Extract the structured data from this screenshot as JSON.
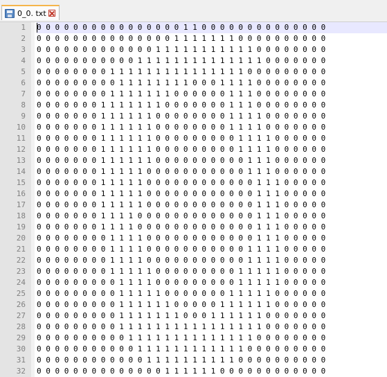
{
  "tab": {
    "label": "0_0. txt"
  },
  "editor": {
    "current_line": 1,
    "line_numbers": [
      "1",
      "2",
      "3",
      "4",
      "5",
      "6",
      "7",
      "8",
      "9",
      "10",
      "11",
      "12",
      "13",
      "14",
      "15",
      "16",
      "17",
      "18",
      "19",
      "20",
      "21",
      "22",
      "23",
      "24",
      "25",
      "26",
      "27",
      "28",
      "29",
      "30",
      "31",
      "32"
    ],
    "lines": [
      "0 0 0 0 0 0 0 0 0 0 0 0 0 0 0 0 1 1 0 0 0 0 0 0 0 0 0 0 0 0 0 0",
      "0 0 0 0 0 0 0 0 0 0 0 0 0 0 0 1 1 1 1 1 1 1 0 0 0 0 0 0 0 0 0 0",
      "0 0 0 0 0 0 0 0 0 0 0 0 0 1 1 1 1 1 1 1 1 1 1 1 0 0 0 0 0 0 0 0",
      "0 0 0 0 0 0 0 0 0 0 0 1 1 1 1 1 1 1 1 1 1 1 1 1 1 0 0 0 0 0 0 0",
      "0 0 0 0 0 0 0 0 1 1 1 1 1 1 1 1 1 1 1 1 1 1 1 0 0 0 0 0 0 0 0 0",
      "0 0 0 0 0 0 0 0 0 1 1 1 1 1 1 1 1 0 0 0 1 1 1 1 0 0 0 0 0 0 0 0",
      "0 0 0 0 0 0 0 0 1 1 1 1 1 1 1 0 0 0 0 0 0 1 1 1 0 0 0 0 0 0 0 0",
      "0 0 0 0 0 0 0 1 1 1 1 1 1 1 0 0 0 0 0 0 0 1 1 1 0 0 0 0 0 0 0 0",
      "0 0 0 0 0 0 0 1 1 1 1 1 1 0 0 0 0 0 0 0 0 1 1 1 1 0 0 0 0 0 0 0",
      "0 0 0 0 0 0 0 1 1 1 1 1 1 0 0 0 0 0 0 0 0 1 1 1 1 0 0 0 0 0 0 0",
      "0 0 0 0 0 0 0 1 1 1 1 1 1 0 0 0 0 0 0 0 0 0 1 1 1 1 0 0 0 0 0 0",
      "0 0 0 0 0 0 0 1 1 1 1 1 1 0 0 0 0 0 0 0 0 0 1 1 1 1 0 0 0 0 0 0",
      "0 0 0 0 0 0 0 1 1 1 1 1 1 0 0 0 0 0 0 0 0 0 0 1 1 1 0 0 0 0 0 0",
      "0 0 0 0 0 0 0 1 1 1 1 1 0 0 0 0 0 0 0 0 0 0 0 1 1 1 0 0 0 0 0 0",
      "0 0 0 0 0 0 0 1 1 1 1 1 0 0 0 0 0 0 0 0 0 0 0 0 1 1 1 0 0 0 0 0",
      "0 0 0 0 0 0 0 1 1 1 1 1 0 0 0 0 0 0 0 0 0 0 0 0 1 1 1 0 0 0 0 0",
      "0 0 0 0 0 0 0 1 1 1 1 1 0 0 0 0 0 0 0 0 0 0 0 0 1 1 1 0 0 0 0 0",
      "0 0 0 0 0 0 0 1 1 1 1 0 0 0 0 0 0 0 0 0 0 0 0 0 1 1 1 0 0 0 0 0",
      "0 0 0 0 0 0 0 1 1 1 1 0 0 0 0 0 0 0 0 0 0 0 0 0 1 1 1 0 0 0 0 0",
      "0 0 0 0 0 0 0 0 1 1 1 1 0 0 0 0 0 0 0 0 0 0 0 0 1 1 1 0 0 0 0 0",
      "0 0 0 0 0 0 0 0 1 1 1 1 0 0 0 0 0 0 0 0 0 0 0 1 1 1 1 0 0 0 0 0",
      "0 0 0 0 0 0 0 0 1 1 1 1 0 0 0 0 0 0 0 0 0 0 0 1 1 1 1 0 0 0 0 0",
      "0 0 0 0 0 0 0 0 1 1 1 1 1 0 0 0 0 0 0 0 0 0 1 1 1 1 1 0 0 0 0 0",
      "0 0 0 0 0 0 0 0 0 1 1 1 1 0 0 0 0 0 0 0 0 0 1 1 1 1 1 0 0 0 0 0",
      "0 0 0 0 0 0 0 0 0 1 1 1 1 1 0 0 0 0 0 0 0 1 1 1 1 1 0 0 0 0 0 0",
      "0 0 0 0 0 0 0 0 0 1 1 1 1 1 1 0 0 0 0 0 1 1 1 1 1 1 0 0 0 0 0 0",
      "0 0 0 0 0 0 0 0 0 1 1 1 1 1 1 1 0 0 0 1 1 1 1 1 1 0 0 0 0 0 0 0",
      "0 0 0 0 0 0 0 0 0 1 1 1 1 1 1 1 1 1 1 1 1 1 1 1 1 0 0 0 0 0 0 0",
      "0 0 0 0 0 0 0 0 0 0 1 1 1 1 1 1 1 1 1 1 1 1 1 1 0 0 0 0 0 0 0 0",
      "0 0 0 0 0 0 0 0 0 0 0 1 1 1 1 1 1 1 1 1 1 1 1 0 0 0 0 0 0 0 0 0",
      "0 0 0 0 0 0 0 0 0 0 0 0 1 1 1 1 1 1 1 1 1 1 0 0 0 0 0 0 0 0 0 0",
      "0 0 0 0 0 0 0 0 0 0 0 0 0 0 1 1 1 1 1 1 0 0 0 0 0 0 0 0 0 0 0 0"
    ]
  }
}
